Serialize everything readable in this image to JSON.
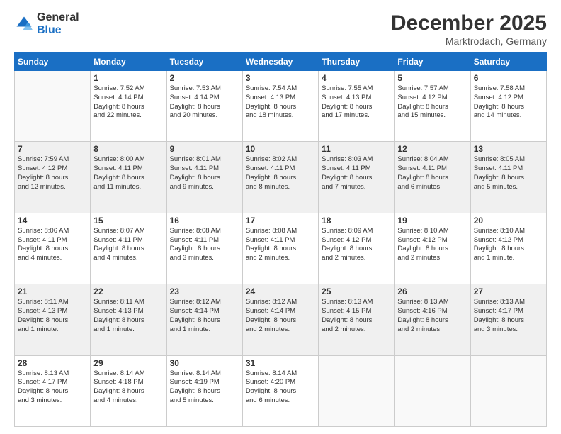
{
  "logo": {
    "general": "General",
    "blue": "Blue"
  },
  "header": {
    "month": "December 2025",
    "location": "Marktrodach, Germany"
  },
  "weekdays": [
    "Sunday",
    "Monday",
    "Tuesday",
    "Wednesday",
    "Thursday",
    "Friday",
    "Saturday"
  ],
  "weeks": [
    [
      {
        "day": "",
        "info": ""
      },
      {
        "day": "1",
        "info": "Sunrise: 7:52 AM\nSunset: 4:14 PM\nDaylight: 8 hours\nand 22 minutes."
      },
      {
        "day": "2",
        "info": "Sunrise: 7:53 AM\nSunset: 4:14 PM\nDaylight: 8 hours\nand 20 minutes."
      },
      {
        "day": "3",
        "info": "Sunrise: 7:54 AM\nSunset: 4:13 PM\nDaylight: 8 hours\nand 18 minutes."
      },
      {
        "day": "4",
        "info": "Sunrise: 7:55 AM\nSunset: 4:13 PM\nDaylight: 8 hours\nand 17 minutes."
      },
      {
        "day": "5",
        "info": "Sunrise: 7:57 AM\nSunset: 4:12 PM\nDaylight: 8 hours\nand 15 minutes."
      },
      {
        "day": "6",
        "info": "Sunrise: 7:58 AM\nSunset: 4:12 PM\nDaylight: 8 hours\nand 14 minutes."
      }
    ],
    [
      {
        "day": "7",
        "info": "Sunrise: 7:59 AM\nSunset: 4:12 PM\nDaylight: 8 hours\nand 12 minutes."
      },
      {
        "day": "8",
        "info": "Sunrise: 8:00 AM\nSunset: 4:11 PM\nDaylight: 8 hours\nand 11 minutes."
      },
      {
        "day": "9",
        "info": "Sunrise: 8:01 AM\nSunset: 4:11 PM\nDaylight: 8 hours\nand 9 minutes."
      },
      {
        "day": "10",
        "info": "Sunrise: 8:02 AM\nSunset: 4:11 PM\nDaylight: 8 hours\nand 8 minutes."
      },
      {
        "day": "11",
        "info": "Sunrise: 8:03 AM\nSunset: 4:11 PM\nDaylight: 8 hours\nand 7 minutes."
      },
      {
        "day": "12",
        "info": "Sunrise: 8:04 AM\nSunset: 4:11 PM\nDaylight: 8 hours\nand 6 minutes."
      },
      {
        "day": "13",
        "info": "Sunrise: 8:05 AM\nSunset: 4:11 PM\nDaylight: 8 hours\nand 5 minutes."
      }
    ],
    [
      {
        "day": "14",
        "info": "Sunrise: 8:06 AM\nSunset: 4:11 PM\nDaylight: 8 hours\nand 4 minutes."
      },
      {
        "day": "15",
        "info": "Sunrise: 8:07 AM\nSunset: 4:11 PM\nDaylight: 8 hours\nand 4 minutes."
      },
      {
        "day": "16",
        "info": "Sunrise: 8:08 AM\nSunset: 4:11 PM\nDaylight: 8 hours\nand 3 minutes."
      },
      {
        "day": "17",
        "info": "Sunrise: 8:08 AM\nSunset: 4:11 PM\nDaylight: 8 hours\nand 2 minutes."
      },
      {
        "day": "18",
        "info": "Sunrise: 8:09 AM\nSunset: 4:12 PM\nDaylight: 8 hours\nand 2 minutes."
      },
      {
        "day": "19",
        "info": "Sunrise: 8:10 AM\nSunset: 4:12 PM\nDaylight: 8 hours\nand 2 minutes."
      },
      {
        "day": "20",
        "info": "Sunrise: 8:10 AM\nSunset: 4:12 PM\nDaylight: 8 hours\nand 1 minute."
      }
    ],
    [
      {
        "day": "21",
        "info": "Sunrise: 8:11 AM\nSunset: 4:13 PM\nDaylight: 8 hours\nand 1 minute."
      },
      {
        "day": "22",
        "info": "Sunrise: 8:11 AM\nSunset: 4:13 PM\nDaylight: 8 hours\nand 1 minute."
      },
      {
        "day": "23",
        "info": "Sunrise: 8:12 AM\nSunset: 4:14 PM\nDaylight: 8 hours\nand 1 minute."
      },
      {
        "day": "24",
        "info": "Sunrise: 8:12 AM\nSunset: 4:14 PM\nDaylight: 8 hours\nand 2 minutes."
      },
      {
        "day": "25",
        "info": "Sunrise: 8:13 AM\nSunset: 4:15 PM\nDaylight: 8 hours\nand 2 minutes."
      },
      {
        "day": "26",
        "info": "Sunrise: 8:13 AM\nSunset: 4:16 PM\nDaylight: 8 hours\nand 2 minutes."
      },
      {
        "day": "27",
        "info": "Sunrise: 8:13 AM\nSunset: 4:17 PM\nDaylight: 8 hours\nand 3 minutes."
      }
    ],
    [
      {
        "day": "28",
        "info": "Sunrise: 8:13 AM\nSunset: 4:17 PM\nDaylight: 8 hours\nand 3 minutes."
      },
      {
        "day": "29",
        "info": "Sunrise: 8:14 AM\nSunset: 4:18 PM\nDaylight: 8 hours\nand 4 minutes."
      },
      {
        "day": "30",
        "info": "Sunrise: 8:14 AM\nSunset: 4:19 PM\nDaylight: 8 hours\nand 5 minutes."
      },
      {
        "day": "31",
        "info": "Sunrise: 8:14 AM\nSunset: 4:20 PM\nDaylight: 8 hours\nand 6 minutes."
      },
      {
        "day": "",
        "info": ""
      },
      {
        "day": "",
        "info": ""
      },
      {
        "day": "",
        "info": ""
      }
    ]
  ]
}
